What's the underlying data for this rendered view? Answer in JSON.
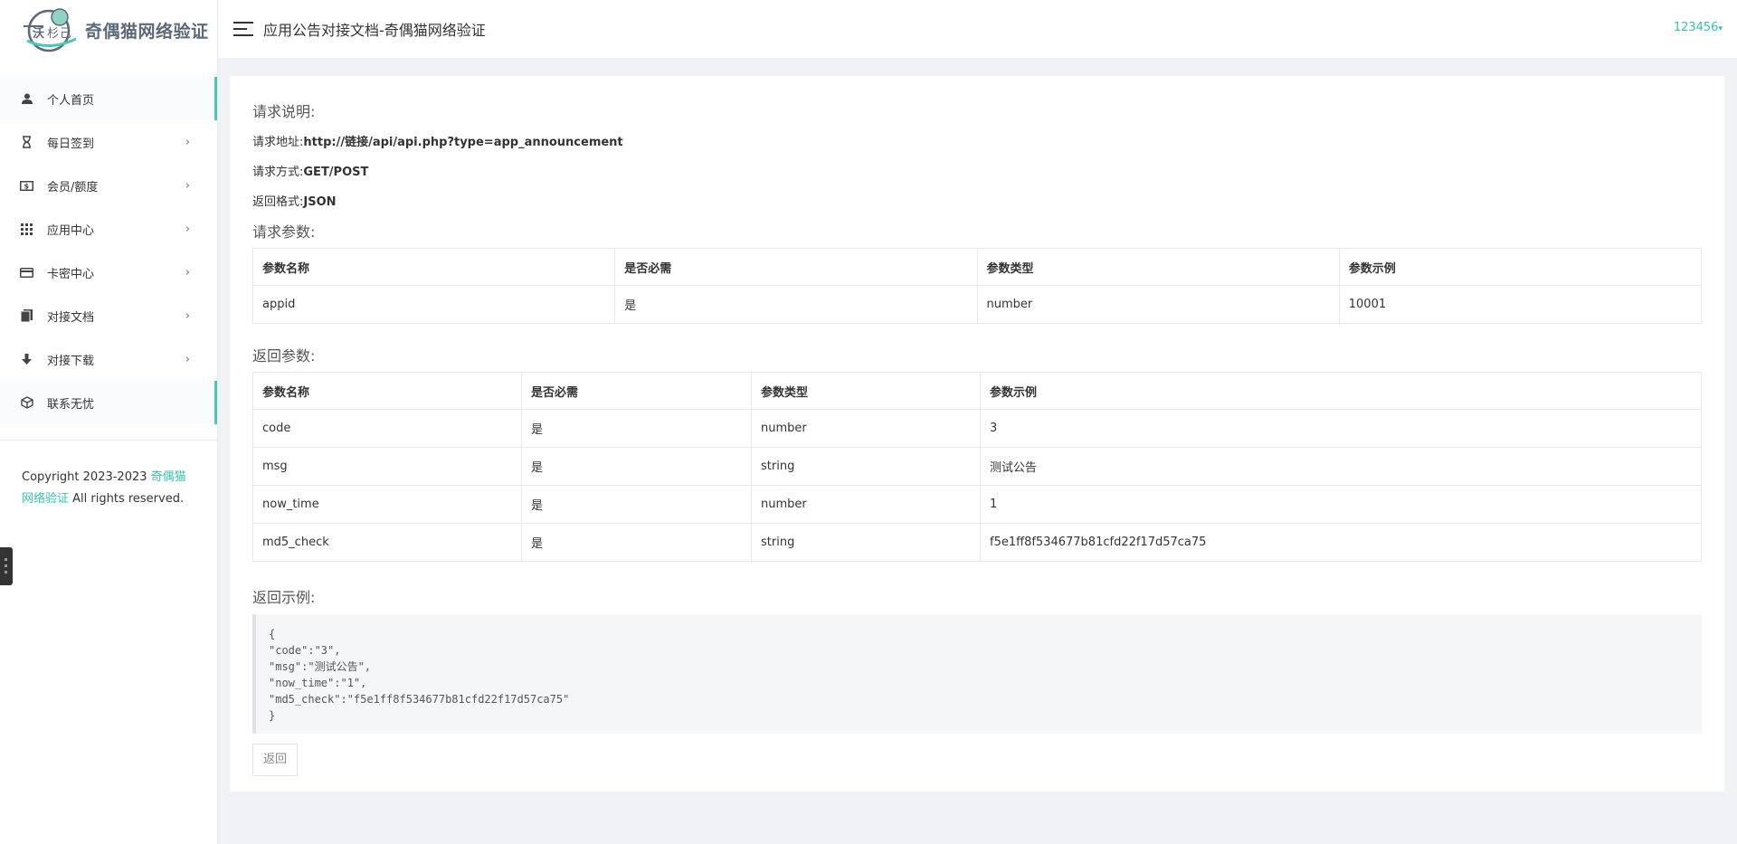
{
  "brand": {
    "name": "奇偶猫网络验证"
  },
  "header": {
    "title": "应用公告对接文档-奇偶猫网络验证",
    "user": "123456"
  },
  "sidebar": {
    "items": [
      {
        "label": "个人首页",
        "icon": "user-icon",
        "arrow": ""
      },
      {
        "label": "每日签到",
        "icon": "hourglass-icon",
        "arrow": "›"
      },
      {
        "label": "会员/额度",
        "icon": "money-icon",
        "arrow": "›"
      },
      {
        "label": "应用中心",
        "icon": "grid-icon",
        "arrow": "›"
      },
      {
        "label": "卡密中心",
        "icon": "card-icon",
        "arrow": "›"
      },
      {
        "label": "对接文档",
        "icon": "book-icon",
        "arrow": "›"
      },
      {
        "label": "对接下载",
        "icon": "download-icon",
        "arrow": "›"
      },
      {
        "label": "联系无忧",
        "icon": "cube-icon",
        "arrow": ""
      }
    ],
    "copyright_prefix": "Copyright 2023-2023 ",
    "copyright_link": "奇偶猫网络验证",
    "copyright_suffix": " All rights reserved."
  },
  "request_desc": {
    "title": "请求说明:",
    "url_label": "请求地址:",
    "url": "http://链接/api/api.php?type=app_announcement",
    "method_label": "请求方式:",
    "method": "GET/POST",
    "format_label": "返回格式:",
    "format": "JSON"
  },
  "request_params": {
    "title": "请求参数:",
    "headers": [
      "参数名称",
      "是否必需",
      "参数类型",
      "参数示例"
    ],
    "rows": [
      [
        "appid",
        "是",
        "number",
        "10001"
      ]
    ]
  },
  "response_params": {
    "title": "返回参数:",
    "headers": [
      "参数名称",
      "是否必需",
      "参数类型",
      "参数示例"
    ],
    "rows": [
      [
        "code",
        "是",
        "number",
        "3"
      ],
      [
        "msg",
        "是",
        "string",
        "测试公告"
      ],
      [
        "now_time",
        "是",
        "number",
        "1"
      ],
      [
        "md5_check",
        "是",
        "string",
        "f5e1ff8f534677b81cfd22f17d57ca75"
      ]
    ]
  },
  "example": {
    "title": "返回示例:",
    "lines": [
      "{",
      "\"code\":\"3\",",
      "\"msg\":\"测试公告\",",
      "\"now_time\":\"1\",",
      "\"md5_check\":\"f5e1ff8f534677b81cfd22f17d57ca75\"",
      "}"
    ]
  },
  "back_button": "返回",
  "colors": {
    "accent": "#33c2ad",
    "active_border": "#4bc8b4"
  }
}
